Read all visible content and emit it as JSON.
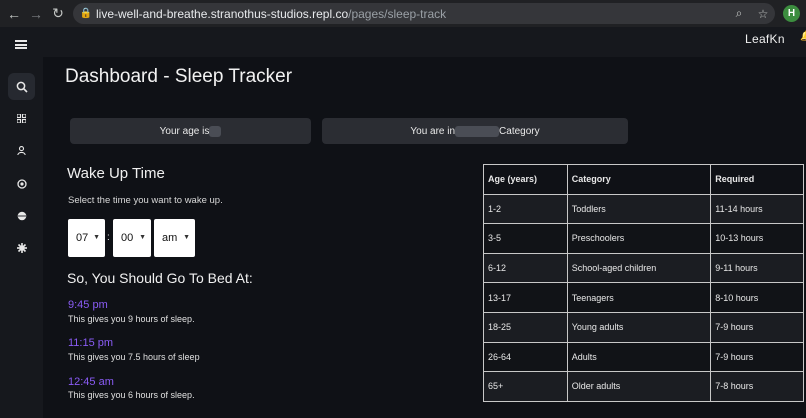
{
  "browser": {
    "url_host": "live-well-and-breathe.stranothus-studios.repl.co",
    "url_path": "/pages/sleep-track",
    "profile_initial": "H"
  },
  "app": {
    "brand": "LeafKn"
  },
  "page": {
    "title": "Dashboard - Sleep Tracker"
  },
  "info": {
    "age_prefix": "Your age is",
    "category_prefix": "You are in",
    "category_suffix": "Category"
  },
  "wake": {
    "title": "Wake Up Time",
    "subtitle": "Select the time you want to wake up.",
    "hour": "07",
    "minute": "00",
    "period": "am",
    "separator": ":"
  },
  "bedtime": {
    "title": "So, You Should Go To Bed At:",
    "options": [
      {
        "time": "9:45 pm",
        "desc": "This gives you 9 hours of sleep."
      },
      {
        "time": "11:15 pm",
        "desc": "This gives you 7.5 hours of sleep"
      },
      {
        "time": "12:45 am",
        "desc": "This gives you 6 hours of sleep."
      }
    ]
  },
  "table": {
    "headers": [
      "Age (years)",
      "Category",
      "Required"
    ],
    "rows": [
      [
        "1-2",
        "Toddlers",
        "11-14 hours"
      ],
      [
        "3-5",
        "Preschoolers",
        "10-13 hours"
      ],
      [
        "6-12",
        "School-aged children",
        "9-11 hours"
      ],
      [
        "13-17",
        "Teenagers",
        "8-10 hours"
      ],
      [
        "18-25",
        "Young adults",
        "7-9 hours"
      ],
      [
        "26-64",
        "Adults",
        "7-9 hours"
      ],
      [
        "65+",
        "Older adults",
        "7-8 hours"
      ]
    ]
  },
  "sidebar": {
    "items": [
      {
        "icon": "search-icon",
        "glyph": "⌕"
      },
      {
        "icon": "grid-icon",
        "glyph": "▦"
      },
      {
        "icon": "user-icon",
        "glyph": "⍝"
      },
      {
        "icon": "target-icon",
        "glyph": "◎"
      },
      {
        "icon": "globe-icon",
        "glyph": "◉"
      },
      {
        "icon": "gear-icon",
        "glyph": "✱"
      }
    ]
  }
}
